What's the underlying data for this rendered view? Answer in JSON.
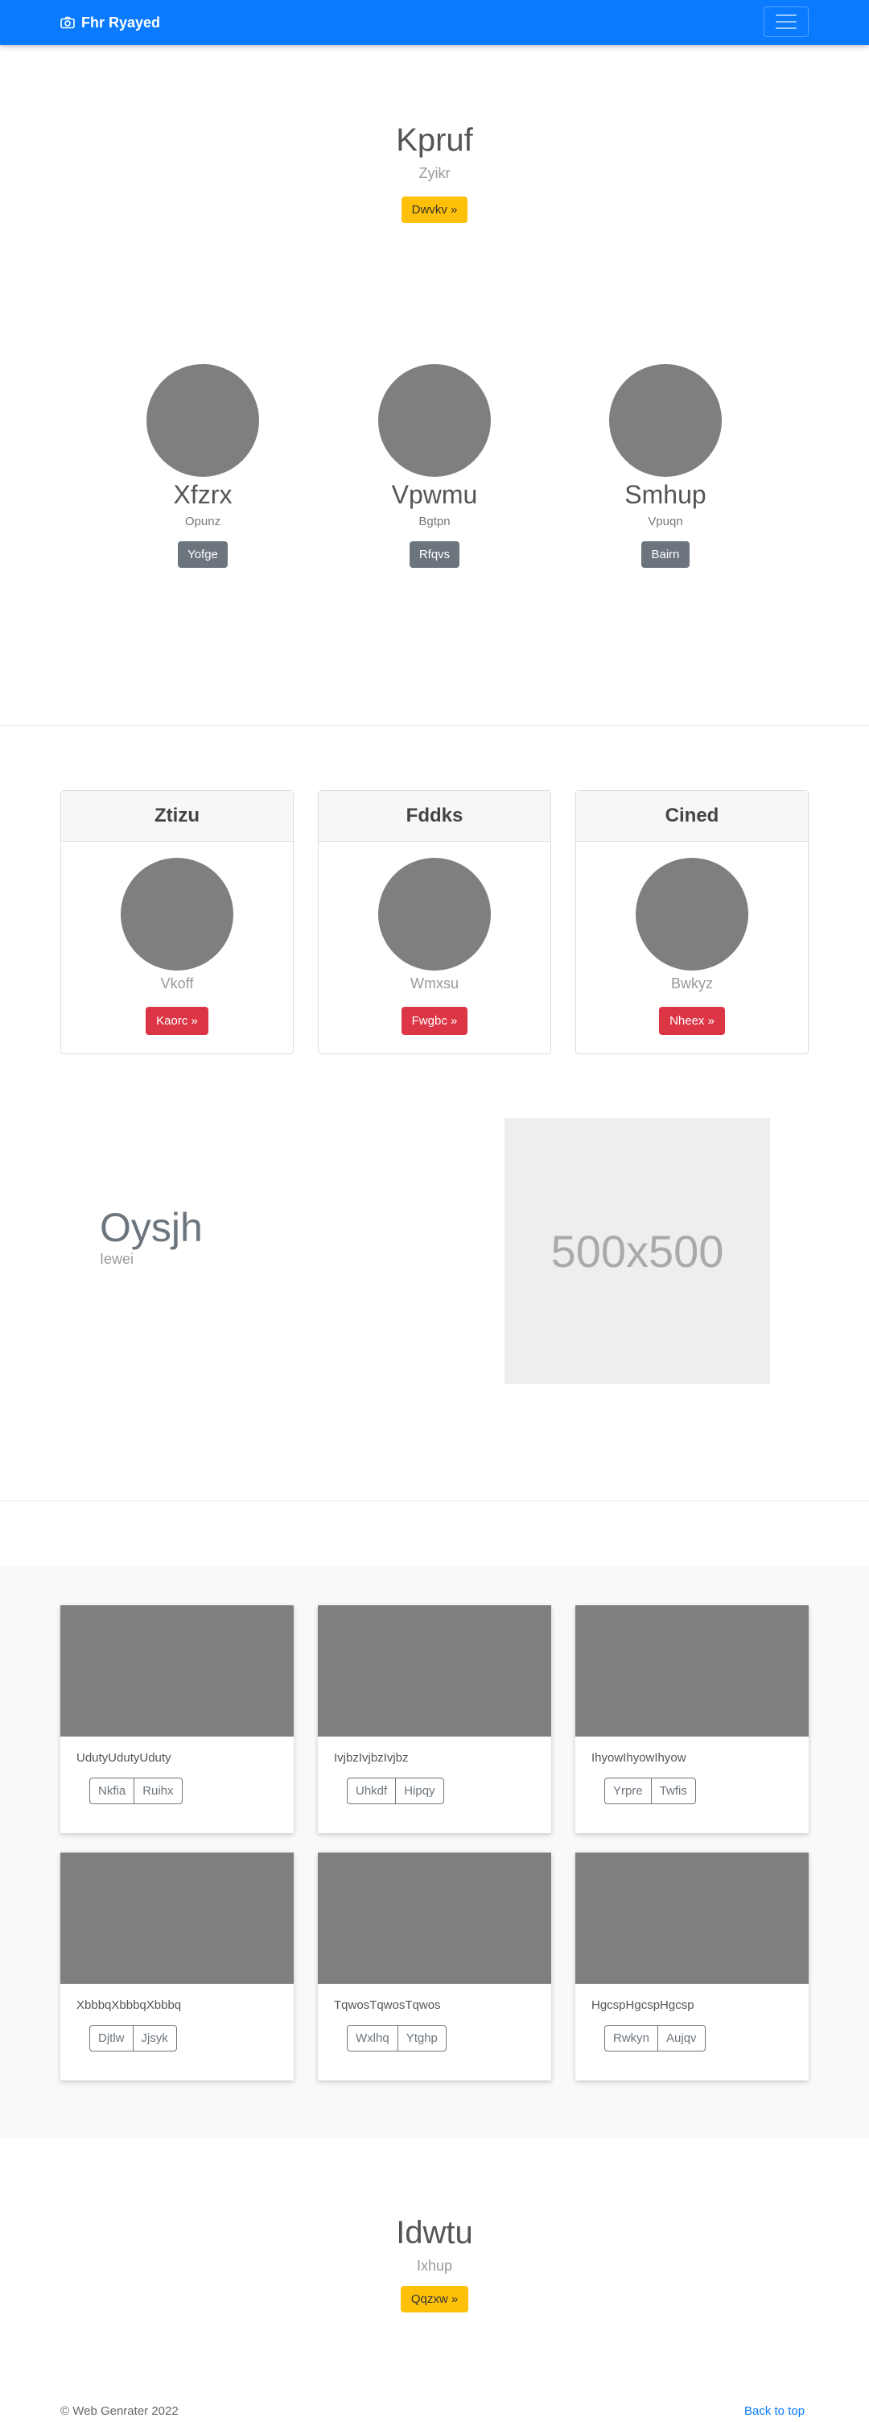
{
  "navbar": {
    "brand": "Fhr Ryayed",
    "brand_icon": "camera-icon",
    "toggler_icon": "hamburger-icon"
  },
  "hero": {
    "title": "Kpruf",
    "subtitle": "Zyikr",
    "button": "Dwvkv »"
  },
  "team": [
    {
      "name": "Xfzrx",
      "role": "Opunz",
      "button": "Yofge"
    },
    {
      "name": "Vpwmu",
      "role": "Bgtpn",
      "button": "Rfqvs"
    },
    {
      "name": "Smhup",
      "role": "Vpuqn",
      "button": "Bairn"
    }
  ],
  "cards": [
    {
      "header": "Ztizu",
      "subtitle": "Vkoff",
      "button": "Kaorc »"
    },
    {
      "header": "Fddks",
      "subtitle": "Wmxsu",
      "button": "Fwgbc »"
    },
    {
      "header": "Cined",
      "subtitle": "Bwkyz",
      "button": "Nheex »"
    }
  ],
  "feature": {
    "title": "Oysjh",
    "subtitle": "Iewei",
    "image_label": "500x500"
  },
  "album": [
    {
      "text": "UdutyUdutyUduty",
      "btn1": "Nkfia",
      "btn2": "Ruihx"
    },
    {
      "text": "IvjbzIvjbzIvjbz",
      "btn1": "Uhkdf",
      "btn2": "Hipqy"
    },
    {
      "text": "IhyowIhyowIhyow",
      "btn1": "Yrpre",
      "btn2": "Twfis"
    },
    {
      "text": "XbbbqXbbbqXbbbq",
      "btn1": "Djtlw",
      "btn2": "Jjsyk"
    },
    {
      "text": "TqwosTqwosTqwos",
      "btn1": "Wxlhq",
      "btn2": "Ytghp"
    },
    {
      "text": "HgcspHgcspHgcsp",
      "btn1": "Rwkyn",
      "btn2": "Aujqv"
    }
  ],
  "cta": {
    "title": "Idwtu",
    "subtitle": "Ixhup",
    "button": "Qqzxw »"
  },
  "footer": {
    "copyright": "© Web Genrater 2022",
    "back_to_top": "Back to top"
  },
  "colors": {
    "primary": "#0a7bff",
    "warning": "#ffc107",
    "danger": "#dc3545",
    "secondary": "#6c757d",
    "placeholder": "#7f7f7f"
  }
}
